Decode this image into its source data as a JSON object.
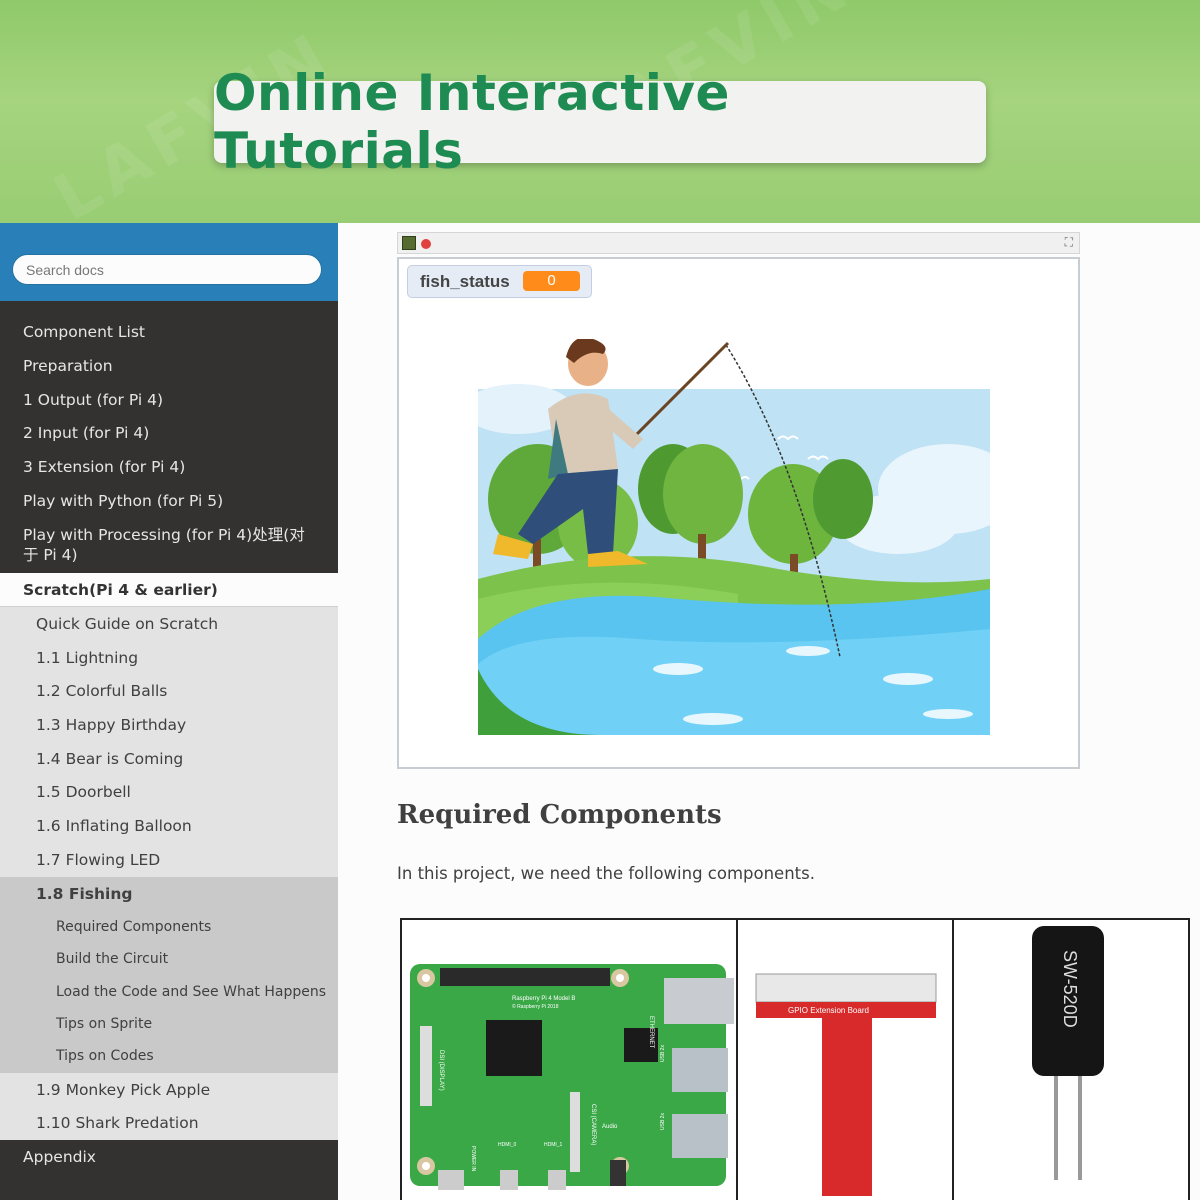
{
  "banner": {
    "title": "Online Interactive Tutorials"
  },
  "search": {
    "placeholder": "Search docs"
  },
  "nav": {
    "items": [
      "Component List",
      "Preparation",
      "1 Output (for Pi 4)",
      "2 Input (for Pi 4)",
      "3 Extension (for Pi 4)",
      "Play with Python (for Pi 5)",
      "Play with Processing (for Pi 4)处理(对于 Pi 4)"
    ],
    "current": "Scratch(Pi 4 & earlier)",
    "sub_items": [
      "Quick Guide on Scratch",
      "1.1 Lightning",
      "1.2 Colorful Balls",
      "1.3 Happy Birthday",
      "1.4 Bear is Coming",
      "1.5 Doorbell",
      "1.6 Inflating Balloon",
      "1.7 Flowing LED",
      "1.8 Fishing"
    ],
    "sub_sub_items": [
      "Required Components",
      "Build the Circuit",
      "Load the Code and See What Happens",
      "Tips on Sprite",
      "Tips on Codes"
    ],
    "after_items": [
      "1.9 Monkey Pick Apple",
      "1.10 Shark Predation"
    ],
    "appendix": "Appendix"
  },
  "stage": {
    "variable_name": "fish_status",
    "variable_value": "0"
  },
  "content": {
    "heading": "Required Components",
    "paragraph": "In this project, we need the following components."
  },
  "components": {
    "pi": {
      "label_line1": "Raspberry Pi 4 Model B",
      "label_line2": "© Raspberry Pi 2018",
      "ethernet": "ETHERNET",
      "display": "DSI (DISPLAY)",
      "camera": "CSI (CAMERA)",
      "audio": "Audio",
      "power": "POWER IN",
      "hdmi0": "HDMI_0",
      "hdmi1": "HDMI_1",
      "usb2a": "USB 2x",
      "usb2b": "USB 2x"
    },
    "gpio": {
      "label": "GPIO Extension Board"
    },
    "sensor": {
      "label": "SW-520D"
    }
  },
  "colors": {
    "banner_green": "#1e8b52",
    "sidebar": "#343131",
    "search_bar": "#2980b9"
  }
}
